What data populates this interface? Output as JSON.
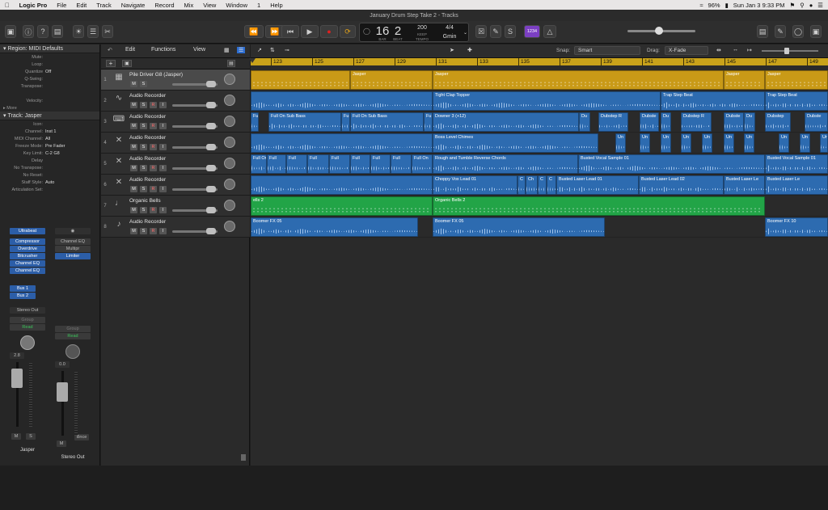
{
  "menubar": {
    "app": "Logic Pro",
    "items": [
      "File",
      "Edit",
      "Track",
      "Navigate",
      "Record",
      "Mix",
      "View",
      "Window",
      "1",
      "Help"
    ],
    "status": {
      "battery": "96%",
      "datetime": "Sun Jan 3  9:33 PM"
    }
  },
  "window": {
    "title": "January Drum Step Take 2 - Tracks"
  },
  "lcd": {
    "bar": "16",
    "beat": "2",
    "bar_label": "BAR",
    "beat_label": "BEAT",
    "tempo": "200",
    "tempo_label1": "KEEP",
    "tempo_label2": "TEMPO",
    "signature": "4/4",
    "key": "Gmin"
  },
  "toolbar": {
    "count_in": "1234"
  },
  "inspector": {
    "region_header": "Region: MIDI Defaults",
    "region_params": [
      {
        "label": "Mute:",
        "value": ""
      },
      {
        "label": "Loop:",
        "value": ""
      },
      {
        "label": "Quantize",
        "value": "Off"
      },
      {
        "label": "Q-Swing:",
        "value": ""
      },
      {
        "label": "Transpose:",
        "value": ""
      },
      {
        "label": "",
        "value": ""
      },
      {
        "label": "Velocity:",
        "value": ""
      }
    ],
    "more": "More",
    "track_header": "Track: Jasper",
    "track_params": [
      {
        "label": "Icon:",
        "value": ""
      },
      {
        "label": "Channel:",
        "value": "Inst 1"
      },
      {
        "label": "MIDI Channel:",
        "value": "All"
      },
      {
        "label": "Freeze Mode:",
        "value": "Pre Fader"
      },
      {
        "label": "Key Limit:",
        "value": "C-2  G8"
      },
      {
        "label": "Delay",
        "value": ""
      },
      {
        "label": "No Transpose:",
        "value": ""
      },
      {
        "label": "No Reset:",
        "value": ""
      },
      {
        "label": "Staff Style:",
        "value": "Auto"
      },
      {
        "label": "Articulation Set:",
        "value": ""
      }
    ],
    "strip1": {
      "instrument": "Ultrabeat",
      "slots": [
        "Compressor",
        "Overdrive",
        "Bitcrusher",
        "Channel EQ",
        "Channel EQ"
      ],
      "sends": [
        "Bus 1",
        "Bus 2"
      ],
      "output": "Stereo Out",
      "group": "Group",
      "auto": "Read",
      "vol": "2.8",
      "mute": "M",
      "solo": "S",
      "name": "Jasper"
    },
    "strip2": {
      "slots": [
        "Channel EQ",
        "Multipr",
        "Limiter"
      ],
      "group": "Group",
      "auto": "Read",
      "vol": "0.0",
      "bounce": "Bnce",
      "mute": "M",
      "solo": "S",
      "name": "Stereo Out"
    }
  },
  "tracks_menu": {
    "edit": "Edit",
    "functions": "Functions",
    "view": "View"
  },
  "arrange_toolbar": {
    "snap_label": "Snap:",
    "snap": "Smart",
    "drag_label": "Drag:",
    "drag": "X-Fade"
  },
  "ruler": [
    "123",
    "125",
    "127",
    "129",
    "131",
    "133",
    "135",
    "137",
    "139",
    "141",
    "143",
    "145",
    "147",
    "149"
  ],
  "tracks": [
    {
      "num": "1",
      "name": "Pile Driver G8 (Jasper)",
      "icon": "drum-machine-icon",
      "type": "midi",
      "buttons": [
        "M",
        "S"
      ],
      "regions": [
        {
          "label": "",
          "start": 0,
          "end": 123.0,
          "color": "midi-y"
        },
        {
          "label": "Jasper",
          "start": 123.0,
          "end": 225.0,
          "color": "midi-y"
        },
        {
          "label": "Jasper",
          "start": 225.0,
          "end": 585.0,
          "color": "midi-y"
        },
        {
          "label": "Jasper",
          "start": 585.0,
          "end": 636.0,
          "color": "midi-y"
        },
        {
          "label": "Jasper",
          "start": 636.0,
          "end": 714,
          "color": "midi-y"
        }
      ]
    },
    {
      "num": "2",
      "name": "Audio Recorder",
      "icon": "waveform-icon",
      "type": "audio",
      "buttons": [
        "M",
        "S",
        "R",
        "I"
      ],
      "regions": [
        {
          "label": "",
          "start": 0,
          "end": 225.0,
          "color": "audio"
        },
        {
          "label": "Tight Clap Topper",
          "start": 225.0,
          "end": 507.0,
          "color": "audio"
        },
        {
          "label": "Trap Step Beat",
          "start": 507.0,
          "end": 636.0,
          "color": "audio"
        },
        {
          "label": "Trap Step Beat",
          "start": 636.0,
          "end": 714,
          "color": "audio"
        }
      ]
    },
    {
      "num": "3",
      "name": "Audio Recorder",
      "icon": "keyboard-icon",
      "type": "audio",
      "buttons": [
        "M",
        "S",
        "R",
        "I"
      ],
      "regions": [
        {
          "label": "Fu",
          "start": 0,
          "end": 10.0,
          "color": "audio"
        },
        {
          "label": "Full On Sub Bass",
          "start": 22.0,
          "end": 112.0,
          "color": "audio"
        },
        {
          "label": "Fu",
          "start": 112.0,
          "end": 123.0,
          "color": "audio"
        },
        {
          "label": "Full On Sub Bass",
          "start": 123.0,
          "end": 214.0,
          "color": "audio"
        },
        {
          "label": "Fu",
          "start": 214.0,
          "end": 225.0,
          "color": "audio"
        },
        {
          "label": "Downer 3 (+12)",
          "start": 225.0,
          "end": 406.0,
          "color": "audio"
        },
        {
          "label": "Du",
          "start": 406.0,
          "end": 420.0,
          "color": "audio"
        },
        {
          "label": "Dubstep R",
          "start": 430.0,
          "end": 467.0,
          "color": "audio"
        },
        {
          "label": "Dubste",
          "start": 481.0,
          "end": 505.0,
          "color": "audio"
        },
        {
          "label": "Du",
          "start": 507.0,
          "end": 520.0,
          "color": "audio"
        },
        {
          "label": "Dubstep R",
          "start": 532.0,
          "end": 570.0,
          "color": "audio"
        },
        {
          "label": "Dubste",
          "start": 585.0,
          "end": 610.0,
          "color": "audio"
        },
        {
          "label": "Du",
          "start": 610.0,
          "end": 624.0,
          "color": "audio"
        },
        {
          "label": "Dubstep",
          "start": 636.0,
          "end": 668.0,
          "color": "audio"
        },
        {
          "label": "Dubste",
          "start": 685.0,
          "end": 714,
          "color": "audio"
        }
      ]
    },
    {
      "num": "4",
      "name": "Audio Recorder",
      "icon": "mic-icon",
      "type": "audio",
      "buttons": [
        "M",
        "S",
        "R",
        "I"
      ],
      "regions": [
        {
          "label": "",
          "start": 0,
          "end": 225.0,
          "color": "audio"
        },
        {
          "label": "Boss Level Chimes",
          "start": 225.0,
          "end": 430.0,
          "color": "audio"
        },
        {
          "label": "Un",
          "start": 451.0,
          "end": 464.0,
          "color": "audio"
        },
        {
          "label": "Un",
          "start": 481.0,
          "end": 494.0,
          "color": "audio"
        },
        {
          "label": "Un",
          "start": 507.0,
          "end": 520.0,
          "color": "audio"
        },
        {
          "label": "Un",
          "start": 532.0,
          "end": 545.0,
          "color": "audio"
        },
        {
          "label": "Un",
          "start": 558.0,
          "end": 571.0,
          "color": "audio"
        },
        {
          "label": "Un",
          "start": 585.0,
          "end": 598.0,
          "color": "audio"
        },
        {
          "label": "Un",
          "start": 610.0,
          "end": 623.0,
          "color": "audio"
        },
        {
          "label": "Un",
          "start": 653.0,
          "end": 666.0,
          "color": "audio"
        },
        {
          "label": "Un",
          "start": 679.0,
          "end": 692.0,
          "color": "audio"
        },
        {
          "label": "Un",
          "start": 704.0,
          "end": 714,
          "color": "audio"
        }
      ]
    },
    {
      "num": "5",
      "name": "Audio Recorder",
      "icon": "mic-icon",
      "type": "audio",
      "buttons": [
        "M",
        "S",
        "R",
        "I"
      ],
      "regions": [
        {
          "label": "Full On",
          "start": 0,
          "end": 20.0,
          "color": "audio"
        },
        {
          "label": "Full",
          "start": 20.0,
          "end": 44.0,
          "color": "audio"
        },
        {
          "label": "Full",
          "start": 44.0,
          "end": 70.0,
          "color": "audio"
        },
        {
          "label": "Full",
          "start": 70.0,
          "end": 97.0,
          "color": "audio"
        },
        {
          "label": "Full",
          "start": 97.0,
          "end": 123.0,
          "color": "audio"
        },
        {
          "label": "Full",
          "start": 123.0,
          "end": 148.0,
          "color": "audio"
        },
        {
          "label": "Full",
          "start": 148.0,
          "end": 173.0,
          "color": "audio"
        },
        {
          "label": "Full",
          "start": 173.0,
          "end": 199.0,
          "color": "audio"
        },
        {
          "label": "Full On",
          "start": 199.0,
          "end": 225.0,
          "color": "audio"
        },
        {
          "label": "Rough and Tumble Reverse Chords",
          "start": 225.0,
          "end": 405.0,
          "color": "audio"
        },
        {
          "label": "Busted Vocal Sample 01",
          "start": 405.0,
          "end": 636.0,
          "color": "audio"
        },
        {
          "label": "Busted Vocal Sample 01",
          "start": 636.0,
          "end": 714,
          "color": "audio"
        }
      ]
    },
    {
      "num": "6",
      "name": "Audio Recorder",
      "icon": "mic-icon",
      "type": "audio",
      "buttons": [
        "M",
        "S",
        "R",
        "I"
      ],
      "regions": [
        {
          "label": "",
          "start": 0,
          "end": 225.0,
          "color": "audio"
        },
        {
          "label": "Choppy Vox Lead 01",
          "start": 225.0,
          "end": 330.0,
          "color": "audio"
        },
        {
          "label": "C",
          "start": 330.0,
          "end": 340.0,
          "color": "audio"
        },
        {
          "label": "Ch",
          "start": 340.0,
          "end": 355.0,
          "color": "audio"
        },
        {
          "label": "C",
          "start": 355.0,
          "end": 366.0,
          "color": "audio"
        },
        {
          "label": "C",
          "start": 366.0,
          "end": 378.0,
          "color": "audio"
        },
        {
          "label": "Busted Laser Lead 01",
          "start": 378.0,
          "end": 480.0,
          "color": "audio"
        },
        {
          "label": "Busted Laser Lead 02",
          "start": 480.0,
          "end": 585.0,
          "color": "audio"
        },
        {
          "label": "Busted Laser Le",
          "start": 585.0,
          "end": 636.0,
          "color": "audio"
        },
        {
          "label": "Busted Laser Le",
          "start": 636.0,
          "end": 714,
          "color": "audio"
        }
      ]
    },
    {
      "num": "7",
      "name": "Organic Bells",
      "icon": "bells-icon",
      "type": "midi",
      "buttons": [
        "M",
        "S",
        "R",
        "I"
      ],
      "regions": [
        {
          "label": "ells 2",
          "start": 0,
          "end": 225.0,
          "color": "midi-g"
        },
        {
          "label": "Organic Bells 2",
          "start": 225.0,
          "end": 636.0,
          "color": "midi-g"
        }
      ]
    },
    {
      "num": "8",
      "name": "Audio Recorder",
      "icon": "guitar-icon",
      "type": "audio",
      "buttons": [
        "M",
        "S",
        "R",
        "I"
      ],
      "regions": [
        {
          "label": "Boomer FX 05",
          "start": 0,
          "end": 207.0,
          "color": "audio"
        },
        {
          "label": "Boomer FX 05",
          "start": 225.0,
          "end": 438.0,
          "color": "audio"
        },
        {
          "label": "Boomer FX 10",
          "start": 636.0,
          "end": 714,
          "color": "audio"
        }
      ]
    }
  ]
}
